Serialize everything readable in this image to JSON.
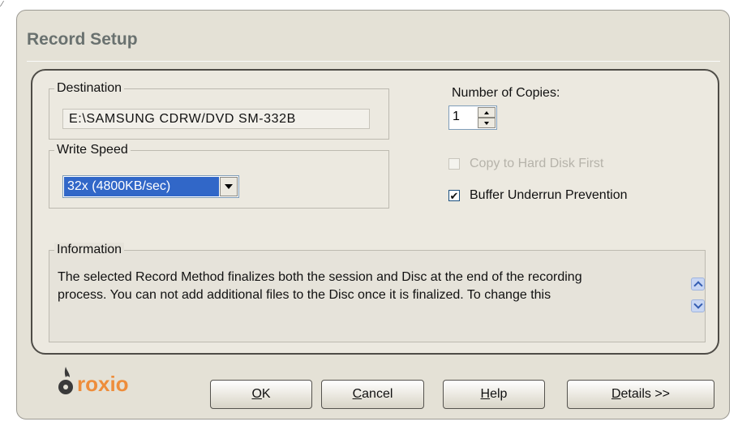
{
  "dialog": {
    "title": "Record Setup",
    "corner_mark": "∕"
  },
  "destination": {
    "group_label": "Destination",
    "value": "E:\\SAMSUNG CDRW/DVD SM-332B"
  },
  "write_speed": {
    "group_label": "Write Speed",
    "selected": "32x (4800KB/sec)"
  },
  "copies": {
    "label": "Number of Copies:",
    "value": "1"
  },
  "options": {
    "copy_to_hard_disk": {
      "label": "Copy to Hard Disk First",
      "checked": false,
      "enabled": false
    },
    "buffer_underrun": {
      "label": "Buffer Underrun Prevention",
      "checked": true,
      "enabled": true,
      "mark": "✔"
    }
  },
  "information": {
    "group_label": "Information",
    "line1": "The selected Record Method finalizes both the session and Disc at the end of the recording",
    "line2": "process. You can not add additional files to the Disc once it is finalized. To change this"
  },
  "logo": {
    "text": "roxio"
  },
  "buttons": {
    "ok": {
      "mnemonic": "O",
      "rest": "K"
    },
    "cancel": {
      "mnemonic": "C",
      "rest": "ancel"
    },
    "help": {
      "mnemonic": "H",
      "rest": "elp"
    },
    "details": {
      "mnemonic": "D",
      "rest": "etails >>"
    }
  },
  "colors": {
    "selection": "#3167c8",
    "logo_orange": "#ee8d3b",
    "title_gray": "#69716f"
  }
}
